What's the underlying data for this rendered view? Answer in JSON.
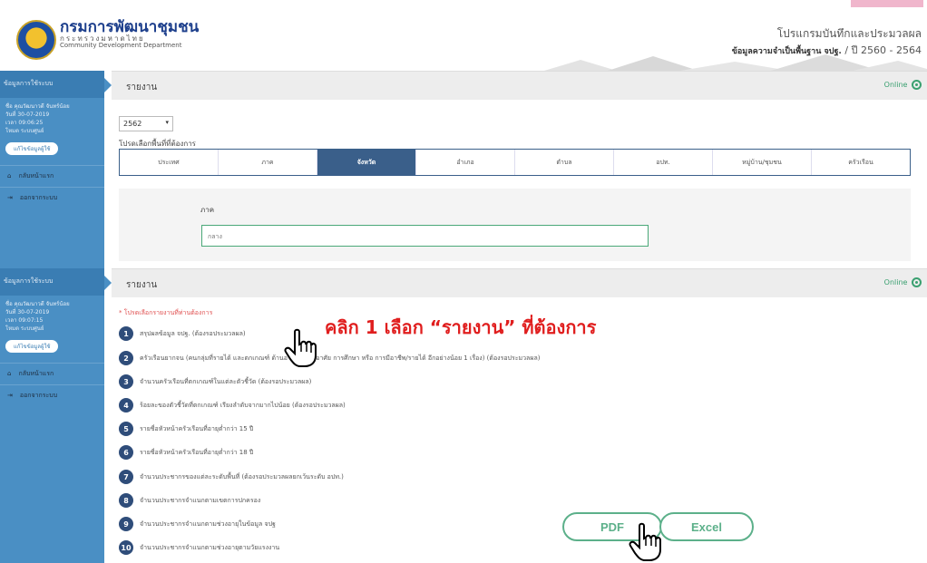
{
  "header": {
    "org_name": "กรมการพัฒนาชุมชน",
    "org_sub_th": "กระทรวงมหาดไทย",
    "org_sub_en": "Community Development Department",
    "system_title": "โปรแกรมบันทึกและประมวลผล",
    "system_sub_bold": "ข้อมูลความจำเป็นพื้นฐาน จปฐ.",
    "system_sub_year": " / ปี 2560 - 2564"
  },
  "sidebar": {
    "head": "ข้อมูลการใช้ระบบ",
    "user_info_1": {
      "line1": "ชื่อ คุณวัฒนาวดี จันทร์น้อย",
      "line2": "วันที่ 30-07-2019",
      "line3": "เวลา 09:06:25",
      "line4": "โหมด ระบบศูนย์"
    },
    "user_info_2": {
      "line1": "ชื่อ คุณวัฒนาวดี จันทร์น้อย",
      "line2": "วันที่ 30-07-2019",
      "line3": "เวลา 09:07:15",
      "line4": "โหมด ระบบศูนย์"
    },
    "edit_button": "แก้ไขข้อมูลผู้ใช้",
    "nav_home": "กลับหน้าแรก",
    "nav_logout": "ออกจากระบบ"
  },
  "panel1": {
    "title": "รายงาน",
    "online": "Online",
    "year": "2562",
    "area_label": "โปรดเลือกพื้นที่ที่ต้องการ",
    "tabs": [
      "ประเทศ",
      "ภาค",
      "จังหวัด",
      "อำเภอ",
      "ตำบล",
      "อปท.",
      "หมู่บ้าน/ชุมชน",
      "ครัวเรือน"
    ],
    "region_label": "ภาค",
    "region_value": "กลาง"
  },
  "panel2": {
    "title": "รายงาน",
    "online": "Online",
    "hint": "* โปรดเลือกรายงานที่ท่านต้องการ",
    "instruction": "คลิก 1 เลือก “รายงาน” ที่ต้องการ",
    "reports": [
      {
        "num": "1",
        "label": "สรุปผลข้อมูล จปฐ. (ต้องรอประมวลผล)"
      },
      {
        "num": "2",
        "label": "ครัวเรือนยากจน (คนกลุ่มที่รายได้ และตกเกณฑ์ ด้านอาหาร ที่อยู่อาศัย การศึกษา หรือ การมีอาชีพ/รายได้ อีกอย่างน้อย 1 เรื่อง) (ต้องรอประมวลผล)"
      },
      {
        "num": "3",
        "label": "จำนวนครัวเรือนที่ตกเกณฑ์ในแต่ละตัวชี้วัด (ต้องรอประมวลผล)"
      },
      {
        "num": "4",
        "label": "ร้อยละของตัวชี้วัดที่ตกเกณฑ์ เรียงลำดับจากมากไปน้อย (ต้องรอประมวลผล)"
      },
      {
        "num": "5",
        "label": "รายชื่อหัวหน้าครัวเรือนที่อายุต่ำกว่า 15 ปี"
      },
      {
        "num": "6",
        "label": "รายชื่อหัวหน้าครัวเรือนที่อายุต่ำกว่า 18 ปี"
      },
      {
        "num": "7",
        "label": "จำนวนประชากรของแต่ละระดับพื้นที่ (ต้องรอประมวลผลยกเว้นระดับ อปท.)"
      },
      {
        "num": "8",
        "label": "จำนวนประชากรจำแนกตามเขตการปกครอง"
      },
      {
        "num": "9",
        "label": "จำนวนประชากรจำแนกตามช่วงอายุในข้อมูล จปฐ"
      },
      {
        "num": "10",
        "label": "จำนวนประชากรจำแนกตามช่วงอายุตามวัยแรงงาน"
      }
    ],
    "pdf_label": "PDF",
    "excel_label": "Excel"
  },
  "colors": {
    "sidebar": "#4a8fc4",
    "tab_active": "#3a5f8a",
    "accent_green": "#5cb08a",
    "instruction_red": "#e01e1e"
  },
  "icons": [
    "logo-emblem",
    "online-indicator-icon",
    "home-icon",
    "logout-icon",
    "hand-pointer-icon"
  ]
}
